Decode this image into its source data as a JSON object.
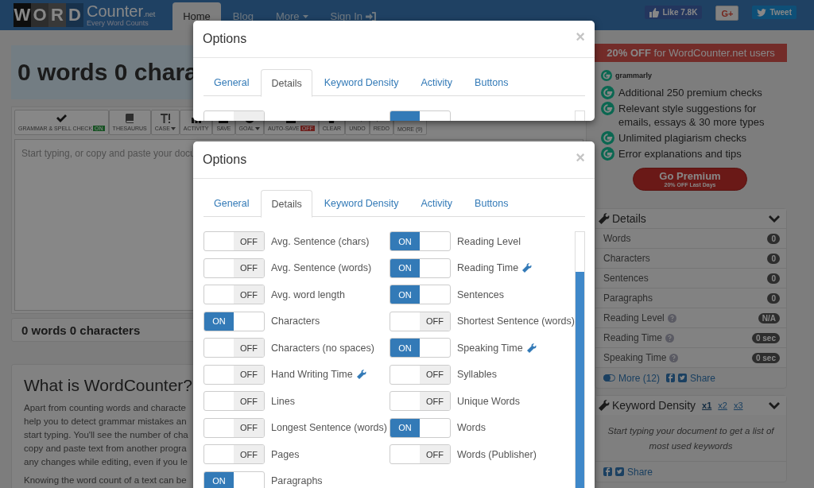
{
  "navbar": {
    "logo_letters": [
      "W",
      "O",
      "R",
      "D"
    ],
    "logo_name": "Counter",
    "logo_domain": ".net",
    "logo_tagline": "Every Word Counts",
    "tabs": [
      {
        "label": "Home",
        "selected": true,
        "kind": "plain"
      },
      {
        "label": "Blog",
        "selected": false,
        "kind": "plain"
      },
      {
        "label": "More",
        "selected": false,
        "kind": "dropdown"
      },
      {
        "label": "Sign In",
        "selected": false,
        "kind": "signin"
      }
    ],
    "social": [
      {
        "kind": "facebook",
        "label": "Like 7.8K"
      },
      {
        "kind": "google",
        "label": "G+"
      },
      {
        "kind": "twitter",
        "label": "Tweet"
      }
    ]
  },
  "editor": {
    "headline": "0 words 0 chara",
    "toolbar": [
      {
        "label": "GRAMMAR & SPELL CHECK",
        "kind": "check",
        "dropdown": false,
        "badge": {
          "text": "ON",
          "on": true
        }
      },
      {
        "label": "THESAURUS",
        "kind": "book",
        "dropdown": false
      },
      {
        "label": "CASE",
        "kind": "case",
        "dropdown": true
      },
      {
        "label": "ACTIVITY",
        "kind": "bars",
        "dropdown": false
      },
      {
        "label": "SAVE",
        "kind": "save",
        "dropdown": false
      },
      {
        "label": "GOAL",
        "kind": "goal",
        "dropdown": true
      },
      {
        "label": "AUTO-SAVE",
        "kind": "save",
        "dropdown": false,
        "badge": {
          "text": "OFF",
          "on": false
        }
      },
      {
        "label": "CLEAR",
        "kind": "clear",
        "dropdown": false
      },
      {
        "label": "UNDO",
        "kind": "undo",
        "dropdown": false
      },
      {
        "label": "REDO",
        "kind": "redo",
        "dropdown": false
      },
      {
        "label": "MORE (9)",
        "kind": "more",
        "dropdown": false
      }
    ],
    "placeholder": "Start typing, or copy and paste your docu",
    "footer": "0 words 0 characters"
  },
  "article": {
    "title": "What is WordCounter?",
    "paragraph_lines": [
      "Apart from counting words and characte",
      "help you to detect grammar mistakes an",
      "start typing. You'll see the number of cha",
      "copy and paste text from another progra",
      "any changes while editing, even if you le"
    ],
    "paragraph_2": "Knowing the word count of a text can be"
  },
  "promo": {
    "banner": "**20% OFF** for WordCounter.net users",
    "brand": "grammarly",
    "features": [
      "Additional 250 premium checks",
      "Relevant style suggestions for emails, essays & 30 more types",
      "Unlimited plagiarism checks",
      "Error explanations and tips"
    ],
    "button": "Go Premium",
    "button_sub": "20% OFF Last Days"
  },
  "details": {
    "title": "Details",
    "rows": [
      {
        "label": "Words",
        "value": "0",
        "help": false
      },
      {
        "label": "Characters",
        "value": "0",
        "help": false
      },
      {
        "label": "Sentences",
        "value": "0",
        "help": false
      },
      {
        "label": "Paragraphs",
        "value": "0",
        "help": false
      },
      {
        "label": "Reading Level",
        "value": "N/A",
        "help": true
      },
      {
        "label": "Reading Time",
        "value": "0 sec",
        "help": true
      },
      {
        "label": "Speaking Time",
        "value": "0 sec",
        "help": true
      }
    ],
    "more": "More (12)",
    "share": "Share"
  },
  "keyword_density": {
    "title": "Keyword Density",
    "options": [
      {
        "label": "x1",
        "selected": true
      },
      {
        "label": "x2",
        "selected": false
      },
      {
        "label": "x3",
        "selected": false
      }
    ],
    "empty_text": "Start typing your document to get a list of most used keywords",
    "share": "Share"
  },
  "modals": [
    {
      "title": "Options",
      "close": "×",
      "tabs": [
        {
          "label": "General",
          "selected": false
        },
        {
          "label": "Details",
          "selected": true
        },
        {
          "label": "Keyword Density",
          "selected": false
        },
        {
          "label": "Activity",
          "selected": false
        },
        {
          "label": "Buttons",
          "selected": false
        }
      ],
      "options": [
        {
          "on": false
        },
        {
          "on": true
        }
      ]
    },
    {
      "title": "Options",
      "close": "×",
      "tabs": [
        {
          "label": "General",
          "selected": false
        },
        {
          "label": "Details",
          "selected": true
        },
        {
          "label": "Keyword Density",
          "selected": false
        },
        {
          "label": "Activity",
          "selected": false
        },
        {
          "label": "Buttons",
          "selected": false
        }
      ],
      "options": [
        {
          "toggle": "OFF",
          "on": false,
          "label": "Avg. Sentence (chars)",
          "wrench": false
        },
        {
          "toggle": "ON",
          "on": true,
          "label": "Reading Level",
          "wrench": false
        },
        {
          "toggle": "OFF",
          "on": false,
          "label": "Avg. Sentence (words)",
          "wrench": false
        },
        {
          "toggle": "ON",
          "on": true,
          "label": "Reading Time",
          "wrench": true
        },
        {
          "toggle": "OFF",
          "on": false,
          "label": "Avg. word length",
          "wrench": false
        },
        {
          "toggle": "ON",
          "on": true,
          "label": "Sentences",
          "wrench": false
        },
        {
          "toggle": "ON",
          "on": true,
          "label": "Characters",
          "wrench": false
        },
        {
          "toggle": "OFF",
          "on": false,
          "label": "Shortest Sentence (words)",
          "wrench": false
        },
        {
          "toggle": "OFF",
          "on": false,
          "label": "Characters (no spaces)",
          "wrench": false
        },
        {
          "toggle": "ON",
          "on": true,
          "label": "Speaking Time",
          "wrench": true
        },
        {
          "toggle": "OFF",
          "on": false,
          "label": "Hand Writing Time",
          "wrench": true
        },
        {
          "toggle": "OFF",
          "on": false,
          "label": "Syllables",
          "wrench": false
        },
        {
          "toggle": "OFF",
          "on": false,
          "label": "Lines",
          "wrench": false
        },
        {
          "toggle": "OFF",
          "on": false,
          "label": "Unique Words",
          "wrench": false
        },
        {
          "toggle": "OFF",
          "on": false,
          "label": "Longest Sentence (words)",
          "wrench": false
        },
        {
          "toggle": "ON",
          "on": true,
          "label": "Words",
          "wrench": false
        },
        {
          "toggle": "OFF",
          "on": false,
          "label": "Pages",
          "wrench": false
        },
        {
          "toggle": "OFF",
          "on": false,
          "label": "Words (Publisher)",
          "wrench": false
        },
        {
          "toggle": "ON",
          "on": true,
          "label": "Paragraphs",
          "wrench": false
        }
      ]
    }
  ]
}
